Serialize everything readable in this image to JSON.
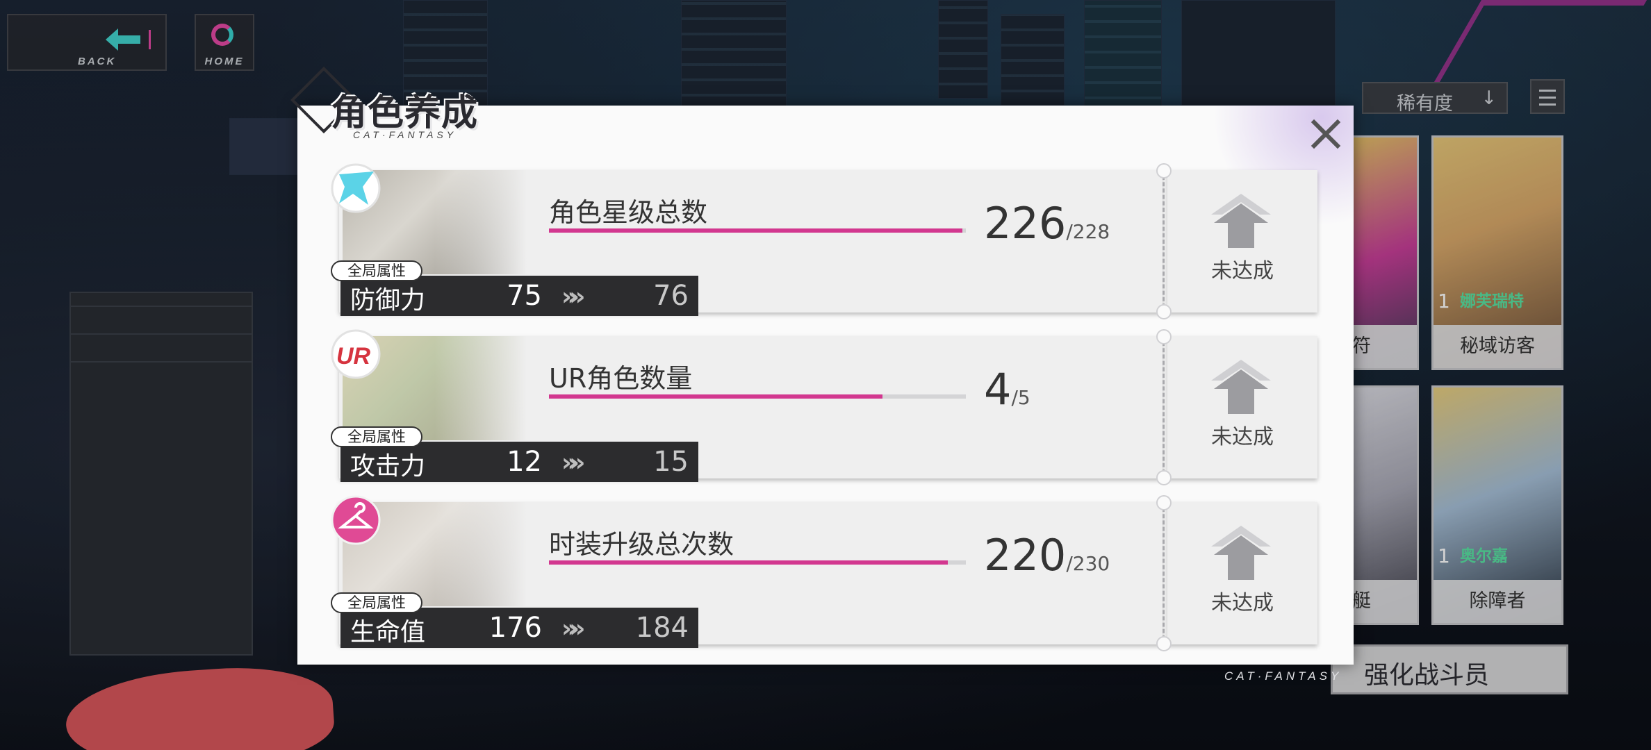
{
  "nav": {
    "back_label": "BACK",
    "home_label": "HOME"
  },
  "dialog": {
    "title": "角色养成",
    "subtitle": "CAT·FANTASY",
    "close_label": "×",
    "rows": [
      {
        "icon": "star-icon",
        "label": "角色星级总数",
        "current": "226",
        "total": "/228",
        "progress": 0.991,
        "tag": "全局属性",
        "stat_name": "防御力",
        "stat_from": "75",
        "stat_to": "76",
        "status": "未达成"
      },
      {
        "icon": "ur-badge-icon",
        "label": "UR角色数量",
        "current": "4",
        "total": "/5",
        "progress": 0.8,
        "tag": "全局属性",
        "stat_name": "攻击力",
        "stat_from": "12",
        "stat_to": "15",
        "status": "未达成"
      },
      {
        "icon": "hanger-icon",
        "label": "时装升级总次数",
        "current": "220",
        "total": "/230",
        "progress": 0.957,
        "tag": "全局属性",
        "stat_name": "生命值",
        "stat_from": "176",
        "stat_to": "184",
        "status": "未达成"
      }
    ]
  },
  "side_panel": {
    "sort_label": "稀有度",
    "sort_arrow": "↓",
    "cards": [
      {
        "name": "音符",
        "level": "",
        "gname": ""
      },
      {
        "name": "秘域访客",
        "level": "1",
        "gname": "娜芙瑞特"
      },
      {
        "name": "潜艇",
        "level": "",
        "gname": ""
      },
      {
        "name": "除障者",
        "level": "1",
        "gname": "奥尔嘉"
      }
    ],
    "enhance_label": "强化战斗员",
    "watermark": "CAT·FANTASY"
  },
  "colors": {
    "accent_pink": "#d2378f",
    "dialog_bg": "#fafafa"
  }
}
